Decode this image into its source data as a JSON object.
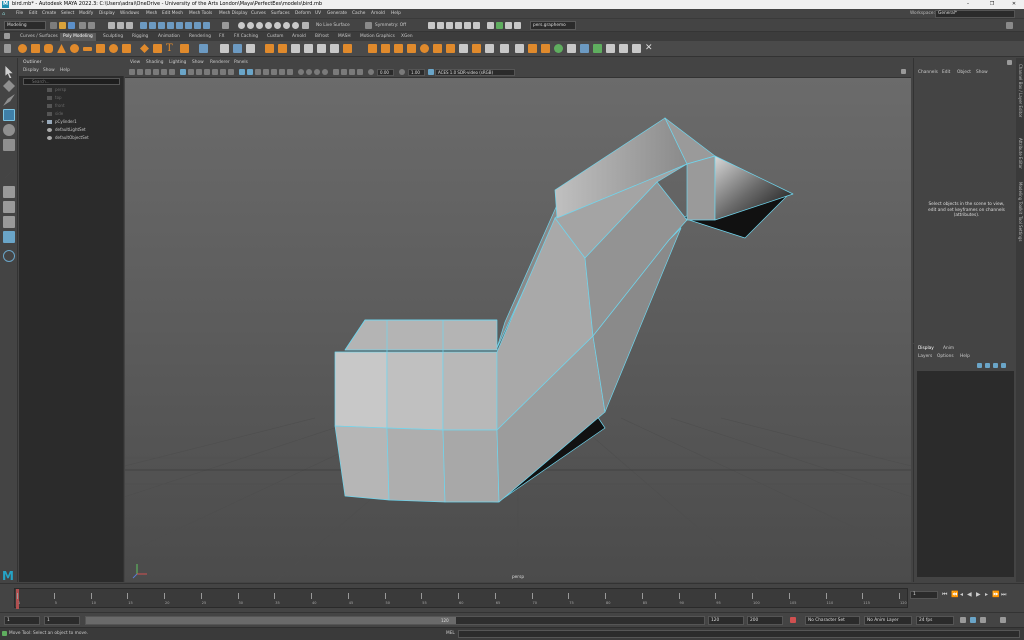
{
  "window": {
    "title": "bird.mb* - Autodesk MAYA 2022.3: C:\\Users\\adrai\\OneDrive - University of the Arts London\\Maya\\PerfectEes\\models\\bird.mb",
    "minimize": "–",
    "maximize": "❐",
    "close": "✕"
  },
  "menubar": {
    "items": [
      "File",
      "Edit",
      "Create",
      "Select",
      "Modify",
      "Display",
      "Windows",
      "Mesh",
      "Edit Mesh",
      "Mesh Tools",
      "Mesh Display",
      "Curves",
      "Surfaces",
      "Deform",
      "UV",
      "Generate",
      "Cache",
      "Arnold",
      "Help"
    ],
    "workspace_label": "Workspace:",
    "workspace_value": "General*"
  },
  "statusline": {
    "menuset": "Modeling",
    "live_surface": "No Live Surface",
    "symmetry": "Symmetry: Off",
    "camera_field": "pers.graphemo"
  },
  "shelf": {
    "tabs": [
      "Curves / Surfaces",
      "Poly Modeling",
      "Sculpting",
      "Rigging",
      "Animation",
      "Rendering",
      "FX",
      "FX Caching",
      "Custom",
      "Arnold",
      "Bifrost",
      "MASH",
      "Motion Graphics",
      "XGen"
    ],
    "active_tab": "Poly Modeling"
  },
  "outliner": {
    "title": "Outliner",
    "menus": [
      "Display",
      "Show",
      "Help"
    ],
    "search_placeholder": "Search...",
    "items": [
      {
        "label": "persp",
        "dim": true
      },
      {
        "label": "top",
        "dim": true
      },
      {
        "label": "front",
        "dim": true
      },
      {
        "label": "side",
        "dim": true
      },
      {
        "label": "pCylinder1",
        "dim": false
      },
      {
        "label": "defaultLightSet",
        "dim": false
      },
      {
        "label": "defaultObjectSet",
        "dim": false
      }
    ]
  },
  "viewport": {
    "menus": [
      "View",
      "Shading",
      "Lighting",
      "Show",
      "Renderer",
      "Panels"
    ],
    "exposure": "0.00",
    "gamma": "1.00",
    "color_space": "ACES 1.0 SDR-video (sRGB)",
    "camera_label": "persp"
  },
  "channelbox": {
    "menus": [
      "Channels",
      "Edit",
      "Object",
      "Show"
    ],
    "message": "Select objects in the scene to view, edit and set keyframes on channels (attributes)."
  },
  "side_tabs": [
    "Channel Box / Layer Editor",
    "Attribute Editor",
    "Modeling Toolkit",
    "Tool Settings"
  ],
  "layers": {
    "tabs": [
      "Display",
      "Anim"
    ],
    "menus": [
      "Layers",
      "Options",
      "Help"
    ]
  },
  "timeslider": {
    "ticks": [
      "1",
      "5",
      "10",
      "15",
      "20",
      "25",
      "30",
      "35",
      "40",
      "45",
      "50",
      "55",
      "60",
      "65",
      "70",
      "75",
      "80",
      "85",
      "90",
      "95",
      "100",
      "105",
      "110",
      "115",
      "120"
    ],
    "current_frame": "1"
  },
  "rangeslider": {
    "start": "1",
    "start_inner": "1",
    "range_end_label": "120",
    "end_inner": "120",
    "end": "200",
    "character_set": "No Character Set",
    "anim_layer": "No Anim Layer",
    "fps": "24 fps"
  },
  "helpline": {
    "message": "Move Tool: Select an object to move.",
    "mel_label": "MEL"
  },
  "colors": {
    "maya_blue": "#25a4c6",
    "shelf_orange": "#e08a2c",
    "wire_select": "#6fd6ee",
    "viewport_bg": "#6b6b6b"
  }
}
